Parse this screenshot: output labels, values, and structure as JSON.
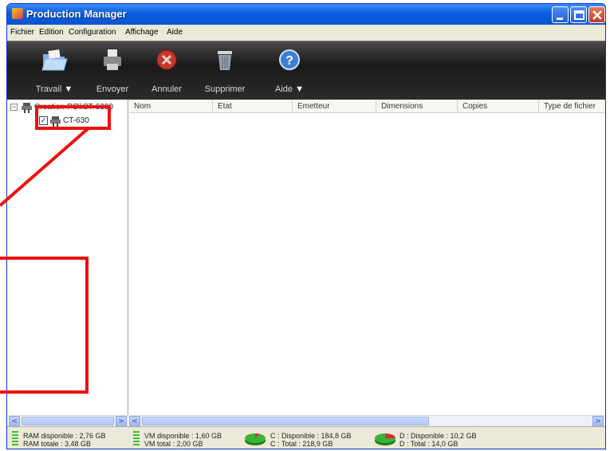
{
  "window": {
    "title": "Production Manager"
  },
  "menu": [
    "Fichier",
    "Edition",
    "Configuration",
    "Affichage",
    "Aide"
  ],
  "toolbar": {
    "travail": "Travail",
    "envoyer": "Envoyer",
    "annuler": "Annuler",
    "supprimer": "Supprimer",
    "aide": "Aide"
  },
  "tree": {
    "root": "Creation-PC\\\\CT-6300",
    "child": "CT-630"
  },
  "columns": [
    "Nom",
    "Etat",
    "Emetteur",
    "Dimensions",
    "Copies",
    "Type de fichier"
  ],
  "status": {
    "ram_available": "RAM disponible : 2,76 GB",
    "ram_total": "RAM totale : 3,48 GB",
    "vm_available": "VM disponible : 1,60 GB",
    "vm_total": "VM total : 2,00 GB",
    "c_available": "C : Disponible : 184,8 GB",
    "c_total": "C : Total : 218,9 GB",
    "d_available": "D : Disponible : 10,2 GB",
    "d_total": "D : Total : 14,0 GB"
  },
  "colors": {
    "callout": "#ee1010",
    "titlebar": "#0a5fe0",
    "toolbar": "#1a1a1a"
  },
  "icons": [
    "folder-open-icon",
    "printer-icon",
    "cancel-icon",
    "trash-icon",
    "help-icon",
    "printer-tree-icon",
    "checkbox-icon",
    "disk-pie-icon"
  ]
}
